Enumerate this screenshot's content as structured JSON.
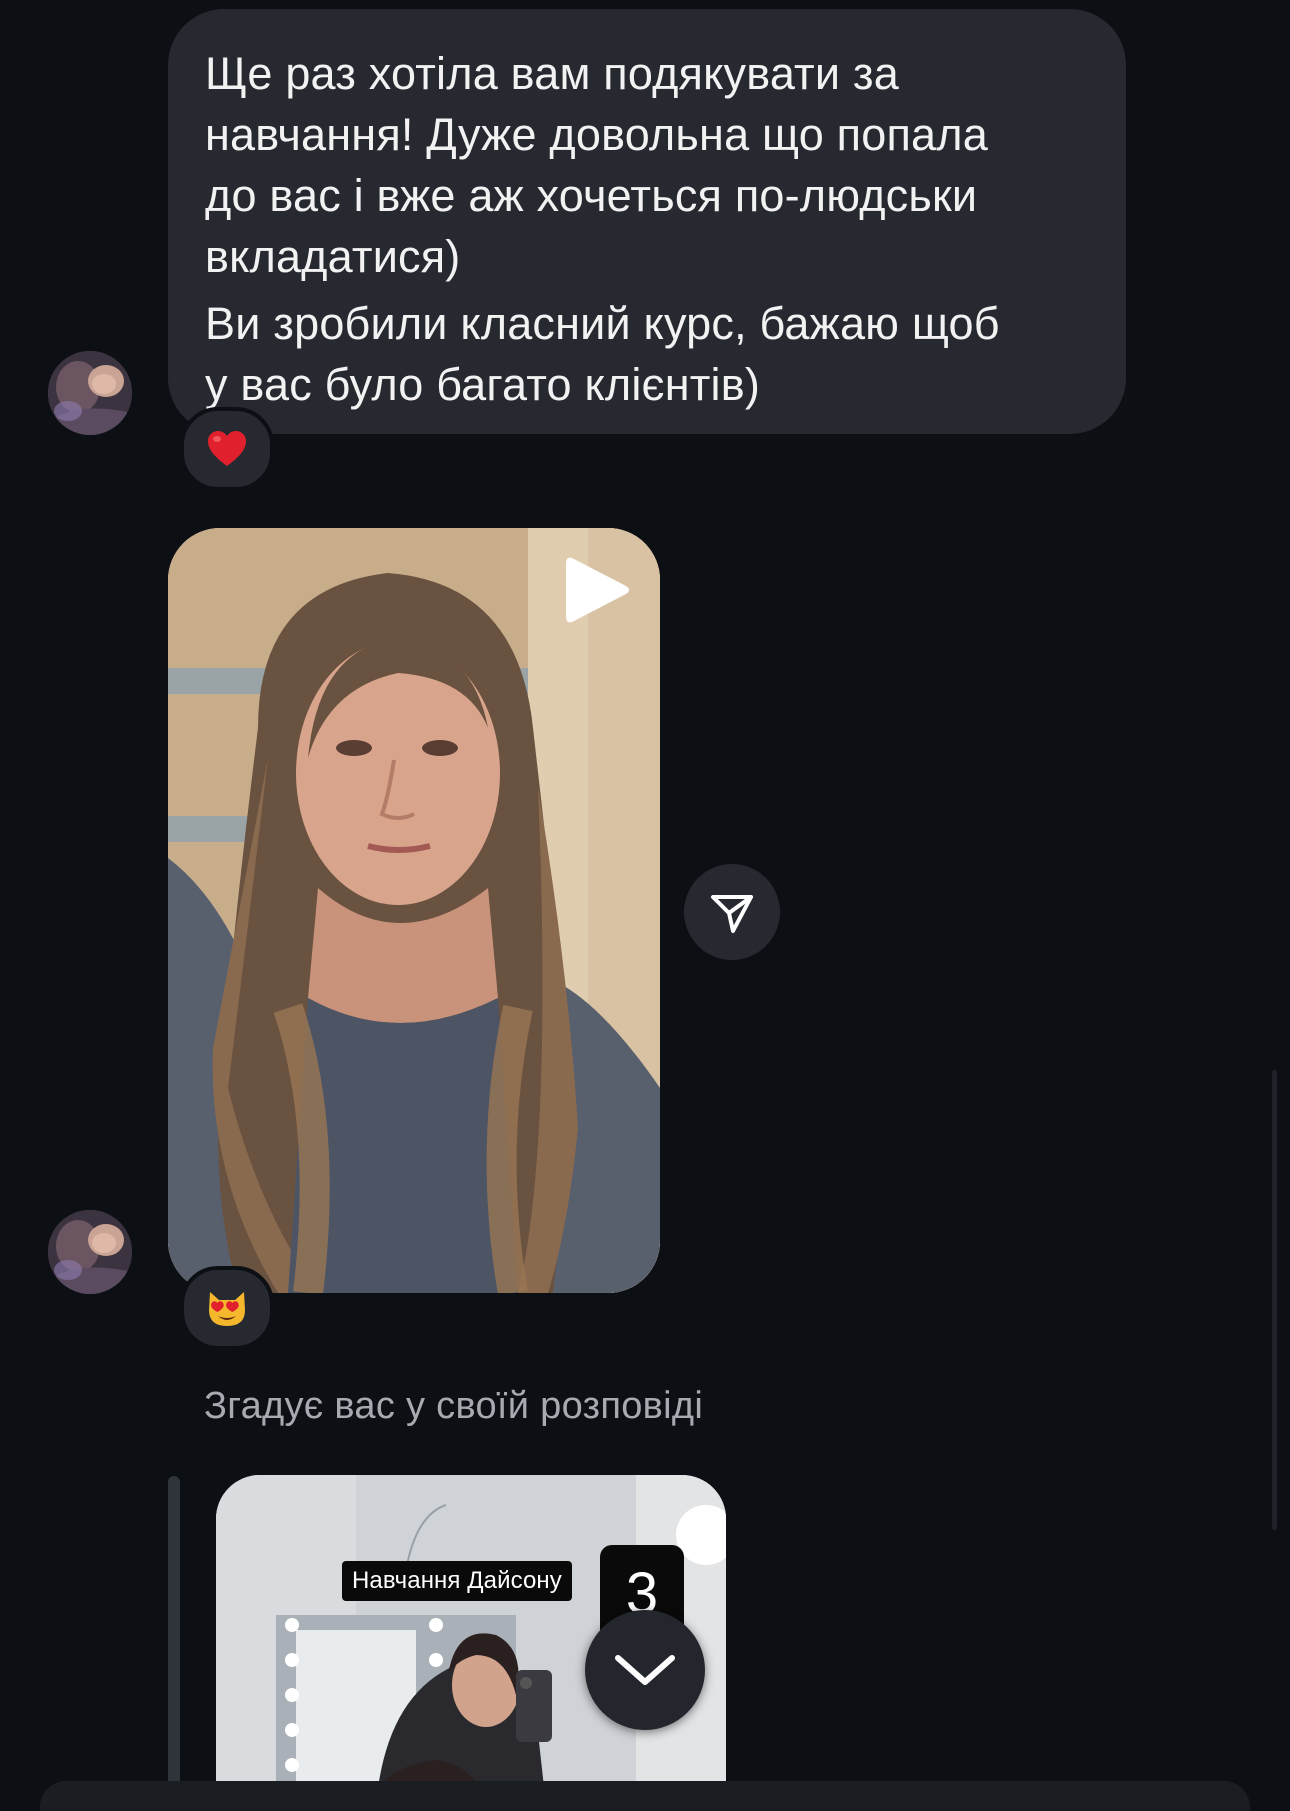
{
  "messages": {
    "text_message": {
      "paragraphs": [
        "Ще раз хотіла вам подякувати за навчання! Дуже довольна що попала до вас і вже аж хочеться по-людськи вкладатися)",
        "Ви зробили класний курс, бажаю щоб у вас було багато клієнтів)"
      ],
      "lines": [
        "Ще раз хотіла вам подякувати за",
        "навчання! Дуже довольна що попала",
        "до вас і вже аж хочеться по-людськи",
        "вкладатися)",
        "Ви зробили класний курс, бажаю щоб",
        "у вас було багато клієнтів)"
      ],
      "reaction": "heart"
    },
    "video_message": {
      "reaction": "smiling-cat-heart-eyes"
    },
    "story_mention": {
      "label": "Згадує вас у своїй розповіді",
      "story_caption": "Навчання Дайсону",
      "story_counter": "3"
    }
  },
  "icons": {
    "play": "play-icon",
    "share": "paper-plane-icon",
    "scroll_down": "chevron-down-icon"
  },
  "colors": {
    "background": "#0c0f14",
    "bubble": "#262a30",
    "secondary_text": "#a7aab0",
    "heart": "#e0202c"
  }
}
